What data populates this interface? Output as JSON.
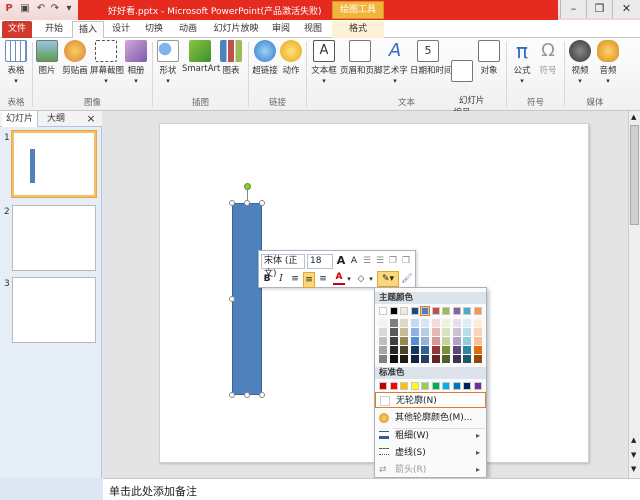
{
  "titlebar": {
    "title": "好好看.pptx - Microsoft PowerPoint(产品激活失败)",
    "context_tab": "绘图工具"
  },
  "tabs": [
    "文件",
    "开始",
    "插入",
    "设计",
    "切换",
    "动画",
    "幻灯片放映",
    "审阅",
    "视图",
    "格式"
  ],
  "ribbon": {
    "buttons": {
      "table": "表格",
      "picture": "图片",
      "clipart": "剪贴画",
      "screenshot": "屏幕截图",
      "album": "相册",
      "shapes": "形状",
      "smartart": "SmartArt",
      "chart": "图表",
      "hyperlink": "超链接",
      "action": "动作",
      "textbox": "文本框",
      "header_footer": "页眉和页脚",
      "wordart": "艺术字",
      "datetime": "日期和时间",
      "slide_number": "幻灯片\n编号",
      "object": "对象",
      "equation": "公式",
      "symbol": "符号",
      "video": "视频",
      "audio": "音频"
    },
    "groups": {
      "table": "表格",
      "image": "图像",
      "illustration": "插图",
      "links": "链接",
      "text": "文本",
      "symbols": "符号",
      "media": "媒体"
    }
  },
  "leftpane": {
    "tab_slides": "幻灯片",
    "tab_outline": "大纲",
    "close": "×",
    "slide_numbers": [
      "1",
      "2",
      "3"
    ]
  },
  "mini_toolbar": {
    "font": "宋体 (正文)",
    "size": "18"
  },
  "dropdown": {
    "theme_colors": "主题颜色",
    "standard_colors": "标准色",
    "no_outline": "无轮廓(N)",
    "more_colors": "其他轮廓颜色(M)...",
    "weight": "粗细(W)",
    "dashes": "虚线(S)",
    "arrows": "箭头(R)"
  },
  "notes": {
    "placeholder": "单击此处添加备注"
  },
  "colors": {
    "accent_red": "#e52b20",
    "shape_fill": "#4f81bd",
    "context_tab": "#f2b53c"
  }
}
